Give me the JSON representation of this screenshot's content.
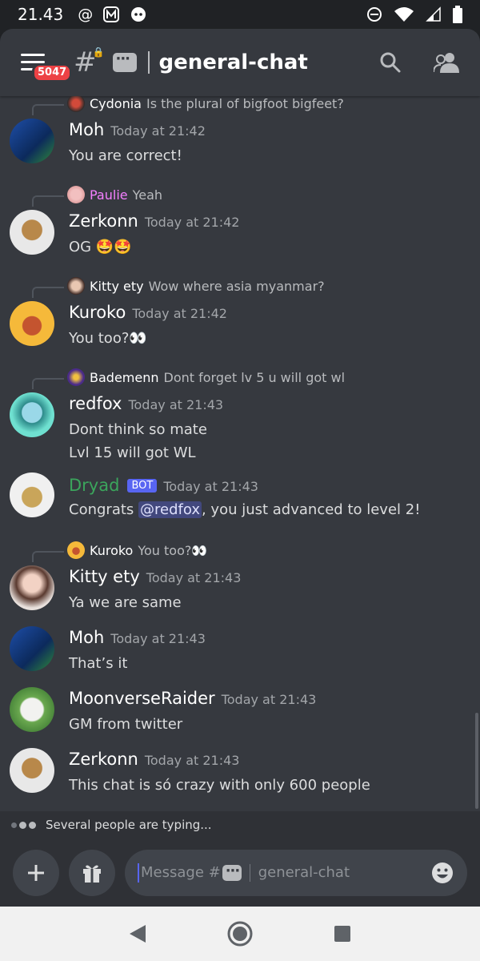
{
  "status_bar": {
    "time": "21.43"
  },
  "header": {
    "badge_count": "5047",
    "channel_name": "general-chat"
  },
  "messages": [
    {
      "reply_to": {
        "name": "Cydonia",
        "text": "Is the plural of bigfoot bigfeet?",
        "name_color": "#ffffff"
      },
      "author": "Moh",
      "timestamp": "Today at 21:42",
      "lines": [
        "You are correct!"
      ]
    },
    {
      "reply_to": {
        "name": "Paulie",
        "text": "Yeah",
        "name_color": "#f47fff"
      },
      "author": "Zerkonn",
      "timestamp": "Today at 21:42",
      "lines": [
        "OG 🤩🤩"
      ]
    },
    {
      "reply_to": {
        "name": "Kitty ety",
        "text": "Wow where asia myanmar?",
        "name_color": "#ffffff"
      },
      "author": "Kuroko",
      "timestamp": "Today at 21:42",
      "lines": [
        "You too?👀"
      ]
    },
    {
      "reply_to": {
        "name": "Bademenn",
        "text": "Dont forget lv 5 u will got wl",
        "name_color": "#ffffff"
      },
      "author": "redfox",
      "timestamp": "Today at 21:43",
      "lines": [
        "Dont think so mate",
        "Lvl 15 will got WL"
      ]
    },
    {
      "author": "Dryad",
      "author_color": "#3ba55c",
      "bot_tag": "BOT",
      "timestamp": "Today at 21:43",
      "line_prefix": "Congrats ",
      "mention": "@redfox",
      "line_suffix": ", you just advanced to level 2!"
    },
    {
      "reply_to": {
        "name": "Kuroko",
        "text": "You too?👀",
        "name_color": "#ffffff"
      },
      "author": "Kitty ety",
      "timestamp": "Today at 21:43",
      "lines": [
        "Ya we are same"
      ]
    },
    {
      "author": "Moh",
      "timestamp": "Today at 21:43",
      "lines": [
        "That’s it"
      ]
    },
    {
      "author": "MoonverseRaider",
      "timestamp": "Today at 21:43",
      "lines": [
        "GM from twitter"
      ]
    },
    {
      "author": "Zerkonn",
      "timestamp": "Today at 21:43",
      "lines": [
        "This chat is só crazy with only 600 people"
      ]
    }
  ],
  "typing_indicator": "Several people are typing...",
  "composer": {
    "placeholder_prefix": "Message #",
    "placeholder_channel": "general-chat"
  },
  "colors": {
    "background": "#36393f",
    "header": "#202225",
    "accent": "#5865f2",
    "bot_name": "#3ba55c",
    "reply_pink": "#f47fff",
    "badge_red": "#ed4245"
  }
}
